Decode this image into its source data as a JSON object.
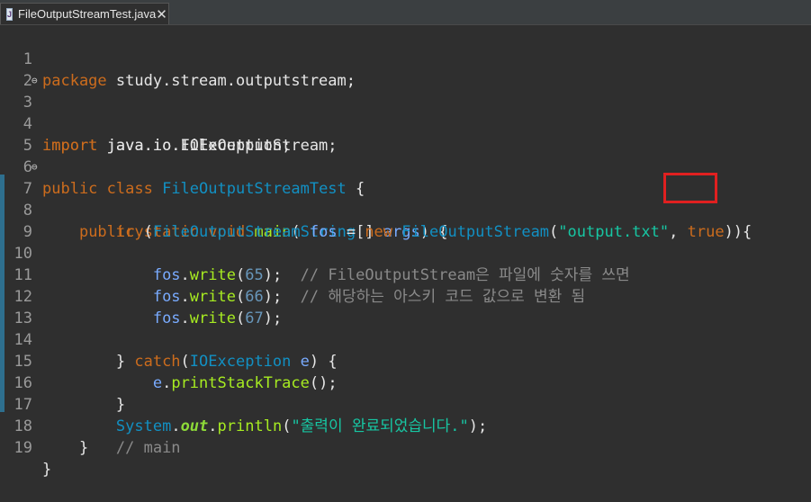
{
  "tab": {
    "title": "FileOutputStreamTest.java",
    "icon_letter": "J",
    "close_glyph": "✕"
  },
  "editor": {
    "lines": [
      {
        "n": "1"
      },
      {
        "n": "2"
      },
      {
        "n": "3",
        "fold": "⊖"
      },
      {
        "n": "4"
      },
      {
        "n": "5"
      },
      {
        "n": "6"
      },
      {
        "n": "7",
        "fold": "⊖"
      },
      {
        "n": "8"
      },
      {
        "n": "9"
      },
      {
        "n": "10"
      },
      {
        "n": "11"
      },
      {
        "n": "12"
      },
      {
        "n": "13"
      },
      {
        "n": "14"
      },
      {
        "n": "15"
      },
      {
        "n": "16"
      },
      {
        "n": "17"
      },
      {
        "n": "18"
      },
      {
        "n": "19"
      }
    ],
    "tokens": {
      "l1": [
        "package",
        " study.stream.outputstream;"
      ],
      "l3": [
        "import",
        " java.io.FileOutputStream;"
      ],
      "l4": [
        "import",
        " java.io.IOException;"
      ],
      "l6": [
        "public class",
        " ",
        "FileOutputStreamTest",
        " {"
      ],
      "l7": [
        "    ",
        "public static void",
        " ",
        "main",
        "(",
        "String",
        "[] ",
        "args",
        ") {"
      ],
      "l8": [
        "        ",
        "try",
        "(",
        "FileOutputStream",
        " ",
        "fos",
        " = ",
        "new",
        " ",
        "FileOutputStream",
        "(",
        "\"output.txt\"",
        ", ",
        "true",
        ")){"
      ],
      "l10": [
        "            ",
        "fos",
        ".",
        "write",
        "(",
        "65",
        ");  ",
        "// FileOutputStream은 파일에 숫자를 쓰면"
      ],
      "l11": [
        "            ",
        "fos",
        ".",
        "write",
        "(",
        "66",
        ");  ",
        "// 해당하는 아스키 코드 값으로 변환 됨"
      ],
      "l12": [
        "            ",
        "fos",
        ".",
        "write",
        "(",
        "67",
        ");"
      ],
      "l14": [
        "        } ",
        "catch",
        "(",
        "IOException",
        " ",
        "e",
        ") {"
      ],
      "l15": [
        "            ",
        "e",
        ".",
        "printStackTrace",
        "();"
      ],
      "l16": [
        "        }"
      ],
      "l17": [
        "        ",
        "System",
        ".",
        "out",
        ".",
        "println",
        "(",
        "\"출력이 완료되었습니다.\"",
        ");"
      ],
      "l18": [
        "    }   ",
        "// main"
      ],
      "l19": [
        "}"
      ]
    }
  },
  "colors": {
    "keyword": "#cc6c1d",
    "class": "#1290c3",
    "method": "#a7ec21",
    "variable": "#79abff",
    "number": "#6897bb",
    "string": "#17c6a3",
    "comment": "#8a8a8a",
    "highlight_box": "#e02020"
  }
}
